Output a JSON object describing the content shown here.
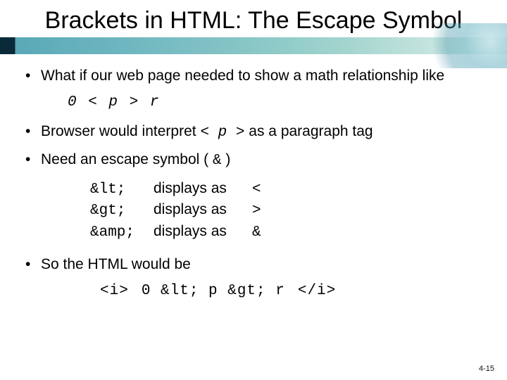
{
  "title": "Brackets in HTML: The Escape Symbol",
  "bullets": {
    "b1": "What if our web page needed to show a math relationship like",
    "b1_code": "0 < p > r",
    "b2_a": "Browser would interpret ",
    "b2_tag": "< p >",
    "b2_b": " as a paragraph tag",
    "b3_a": "Need an escape symbol ( ",
    "b3_amp": "&",
    "b3_b": " )",
    "b4": "So the HTML would be"
  },
  "escape": {
    "label": "displays as",
    "rows": [
      {
        "code": "&lt;",
        "sym": "<"
      },
      {
        "code": "&gt;",
        "sym": ">"
      },
      {
        "code": "&amp;",
        "sym": "&"
      }
    ]
  },
  "html_example": {
    "open": "<i>",
    "body": "0 &lt; p &gt; r",
    "close": "</i>"
  },
  "page_number": "4-15"
}
